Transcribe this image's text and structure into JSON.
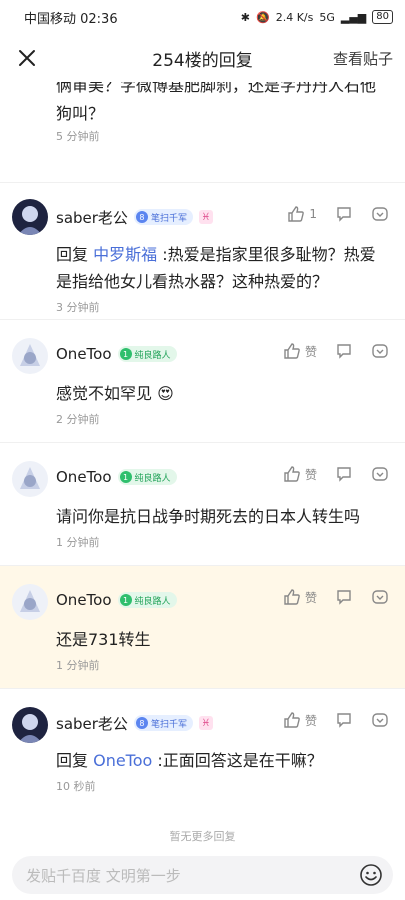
{
  "status": {
    "carrier_time": "中国移动 02:36",
    "net_speed": "2.4 K/s",
    "signal": "5G",
    "battery": "80"
  },
  "header": {
    "title": "254楼的回复",
    "view_post": "查看贴子"
  },
  "partial_reply": {
    "text": "俩审美？字微博基肥脚刹，还是字丹丹人石他狗叫？",
    "time": "5 分钟前"
  },
  "replies": [
    {
      "user": "saber老公",
      "badge_level": "8",
      "badge": "笔扫千军",
      "zodiac": "♓",
      "like": "1",
      "prefix": "回复 ",
      "mention": "中罗斯福",
      "text": " :热爱是指家里很多耻物？热爱是指给他女儿看热水器？这种热爱的？",
      "time": "3 分钟前"
    },
    {
      "user": "OneToo",
      "badge_level": "1",
      "badge": "纯良路人",
      "like": "赞",
      "text": "感觉不如罕见 😍",
      "time": "2 分钟前"
    },
    {
      "user": "OneToo",
      "badge_level": "1",
      "badge": "纯良路人",
      "like": "赞",
      "text": "请问你是抗日战争时期死去的日本人转生吗",
      "time": "1 分钟前"
    },
    {
      "user": "OneToo",
      "badge_level": "1",
      "badge": "纯良路人",
      "like": "赞",
      "text": "还是731转生",
      "time": "1 分钟前"
    },
    {
      "user": "saber老公",
      "badge_level": "8",
      "badge": "笔扫千军",
      "zodiac": "♓",
      "like": "赞",
      "prefix": "回复 ",
      "mention": "OneToo",
      "text": " :正面回答这是在干嘛？",
      "time": "10 秒前"
    }
  ],
  "footer": {
    "no_more": "暂无更多回复",
    "input_placeholder": "发贴千百度 文明第一步"
  }
}
